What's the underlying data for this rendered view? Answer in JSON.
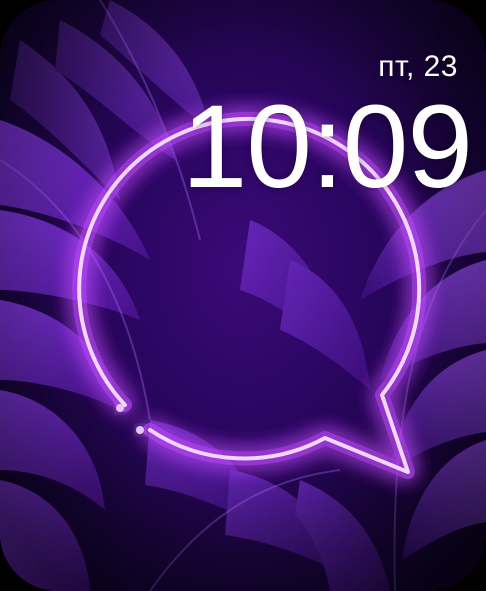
{
  "watch_face": {
    "date": "пт, 23",
    "time": "10:09"
  },
  "colors": {
    "background_deep": "#1a043f",
    "leaf_purple": "#7b2fd6",
    "neon_glow": "#c24bff",
    "neon_core": "#ffffff",
    "text": "#ffffff"
  },
  "icons": {
    "complication": "speech-bubble-icon"
  }
}
